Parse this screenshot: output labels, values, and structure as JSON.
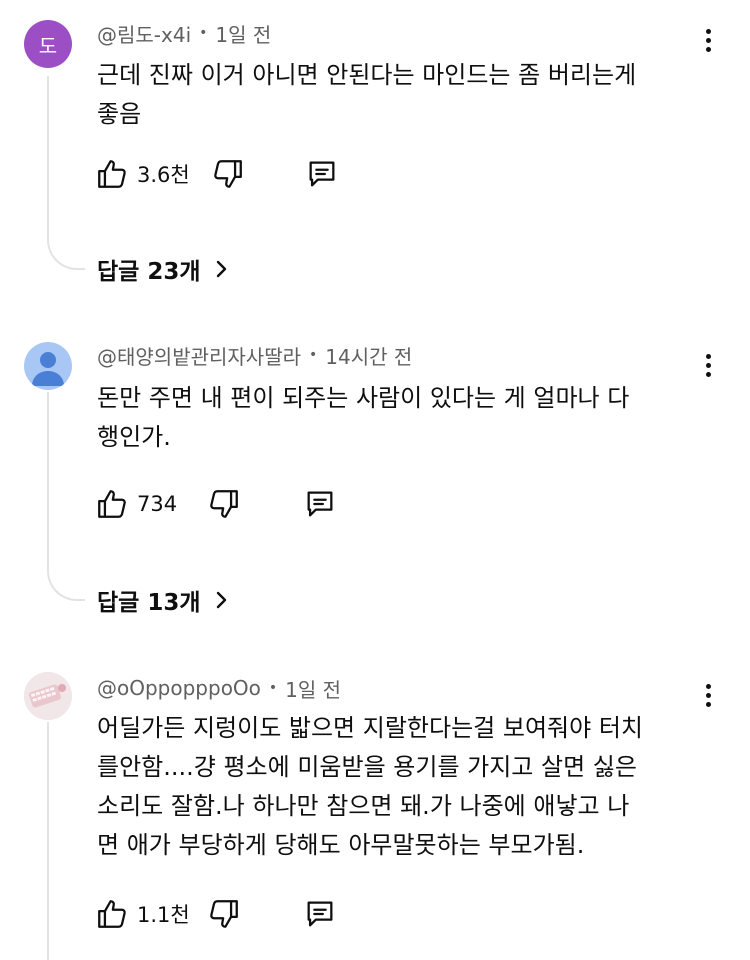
{
  "colors": {
    "avatar_letter_bg": "#9c4fc4",
    "avatar_person_bg": "#a9c7f5",
    "meta_text": "#606060",
    "thread_line": "#e3e3e3"
  },
  "comments": [
    {
      "avatar_letter": "도",
      "author": "@림도-x4i",
      "separator": "•",
      "time": "1일 전",
      "body_lines": [
        "근데 진짜 이거 아니면 안된다는 마인드는 좀 버리는게",
        "좋음"
      ],
      "like_count": "3.6천",
      "replies_label": "답글 23개"
    },
    {
      "author": "@태양의밭관리자사딸라",
      "separator": "•",
      "time": "14시간 전",
      "body_lines": [
        "돈만 주면 내 편이 되주는 사람이 있다는 게 얼마나 다",
        "행인가."
      ],
      "like_count": "734",
      "replies_label": "답글 13개"
    },
    {
      "author": "@oOppopppoOo",
      "separator": "•",
      "time": "1일 전",
      "body_lines": [
        "어딜가든 지렁이도 밟으면 지랄한다는걸 보여줘야 터치",
        "를안함....걍 평소에 미움받을 용기를 가지고 살면 싫은",
        "소리도 잘함.나 하나만 참으면 돼.가 나중에 애낳고 나",
        "면 애가 부당하게 당해도 아무말못하는 부모가됨."
      ],
      "like_count": "1.1천"
    }
  ]
}
